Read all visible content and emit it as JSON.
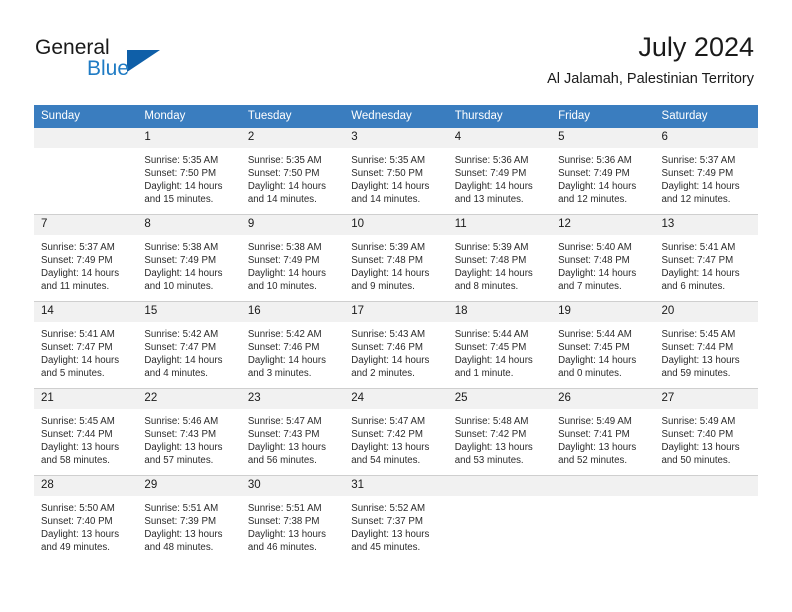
{
  "brand": {
    "name_part1": "General",
    "name_part2": "Blue",
    "accent_color": "#1f7bc4",
    "triangle_color": "#0f5fa8"
  },
  "header": {
    "month_title": "July 2024",
    "location": "Al Jalamah, Palestinian Territory"
  },
  "theme": {
    "header_row_bg": "#3a7dbf",
    "daynum_bg": "#f1f1f1",
    "grid_line": "#cfcfcf",
    "text": "#1a1a1a"
  },
  "weekdays": [
    "Sunday",
    "Monday",
    "Tuesday",
    "Wednesday",
    "Thursday",
    "Friday",
    "Saturday"
  ],
  "weeks": [
    [
      {
        "day": "",
        "sunrise": "",
        "sunset": "",
        "daylight_line1": "",
        "daylight_line2": "",
        "blank": true
      },
      {
        "day": "1",
        "sunrise": "Sunrise: 5:35 AM",
        "sunset": "Sunset: 7:50 PM",
        "daylight_line1": "Daylight: 14 hours",
        "daylight_line2": "and 15 minutes."
      },
      {
        "day": "2",
        "sunrise": "Sunrise: 5:35 AM",
        "sunset": "Sunset: 7:50 PM",
        "daylight_line1": "Daylight: 14 hours",
        "daylight_line2": "and 14 minutes."
      },
      {
        "day": "3",
        "sunrise": "Sunrise: 5:35 AM",
        "sunset": "Sunset: 7:50 PM",
        "daylight_line1": "Daylight: 14 hours",
        "daylight_line2": "and 14 minutes."
      },
      {
        "day": "4",
        "sunrise": "Sunrise: 5:36 AM",
        "sunset": "Sunset: 7:49 PM",
        "daylight_line1": "Daylight: 14 hours",
        "daylight_line2": "and 13 minutes."
      },
      {
        "day": "5",
        "sunrise": "Sunrise: 5:36 AM",
        "sunset": "Sunset: 7:49 PM",
        "daylight_line1": "Daylight: 14 hours",
        "daylight_line2": "and 12 minutes."
      },
      {
        "day": "6",
        "sunrise": "Sunrise: 5:37 AM",
        "sunset": "Sunset: 7:49 PM",
        "daylight_line1": "Daylight: 14 hours",
        "daylight_line2": "and 12 minutes."
      }
    ],
    [
      {
        "day": "7",
        "sunrise": "Sunrise: 5:37 AM",
        "sunset": "Sunset: 7:49 PM",
        "daylight_line1": "Daylight: 14 hours",
        "daylight_line2": "and 11 minutes."
      },
      {
        "day": "8",
        "sunrise": "Sunrise: 5:38 AM",
        "sunset": "Sunset: 7:49 PM",
        "daylight_line1": "Daylight: 14 hours",
        "daylight_line2": "and 10 minutes."
      },
      {
        "day": "9",
        "sunrise": "Sunrise: 5:38 AM",
        "sunset": "Sunset: 7:49 PM",
        "daylight_line1": "Daylight: 14 hours",
        "daylight_line2": "and 10 minutes."
      },
      {
        "day": "10",
        "sunrise": "Sunrise: 5:39 AM",
        "sunset": "Sunset: 7:48 PM",
        "daylight_line1": "Daylight: 14 hours",
        "daylight_line2": "and 9 minutes."
      },
      {
        "day": "11",
        "sunrise": "Sunrise: 5:39 AM",
        "sunset": "Sunset: 7:48 PM",
        "daylight_line1": "Daylight: 14 hours",
        "daylight_line2": "and 8 minutes."
      },
      {
        "day": "12",
        "sunrise": "Sunrise: 5:40 AM",
        "sunset": "Sunset: 7:48 PM",
        "daylight_line1": "Daylight: 14 hours",
        "daylight_line2": "and 7 minutes."
      },
      {
        "day": "13",
        "sunrise": "Sunrise: 5:41 AM",
        "sunset": "Sunset: 7:47 PM",
        "daylight_line1": "Daylight: 14 hours",
        "daylight_line2": "and 6 minutes."
      }
    ],
    [
      {
        "day": "14",
        "sunrise": "Sunrise: 5:41 AM",
        "sunset": "Sunset: 7:47 PM",
        "daylight_line1": "Daylight: 14 hours",
        "daylight_line2": "and 5 minutes."
      },
      {
        "day": "15",
        "sunrise": "Sunrise: 5:42 AM",
        "sunset": "Sunset: 7:47 PM",
        "daylight_line1": "Daylight: 14 hours",
        "daylight_line2": "and 4 minutes."
      },
      {
        "day": "16",
        "sunrise": "Sunrise: 5:42 AM",
        "sunset": "Sunset: 7:46 PM",
        "daylight_line1": "Daylight: 14 hours",
        "daylight_line2": "and 3 minutes."
      },
      {
        "day": "17",
        "sunrise": "Sunrise: 5:43 AM",
        "sunset": "Sunset: 7:46 PM",
        "daylight_line1": "Daylight: 14 hours",
        "daylight_line2": "and 2 minutes."
      },
      {
        "day": "18",
        "sunrise": "Sunrise: 5:44 AM",
        "sunset": "Sunset: 7:45 PM",
        "daylight_line1": "Daylight: 14 hours",
        "daylight_line2": "and 1 minute."
      },
      {
        "day": "19",
        "sunrise": "Sunrise: 5:44 AM",
        "sunset": "Sunset: 7:45 PM",
        "daylight_line1": "Daylight: 14 hours",
        "daylight_line2": "and 0 minutes."
      },
      {
        "day": "20",
        "sunrise": "Sunrise: 5:45 AM",
        "sunset": "Sunset: 7:44 PM",
        "daylight_line1": "Daylight: 13 hours",
        "daylight_line2": "and 59 minutes."
      }
    ],
    [
      {
        "day": "21",
        "sunrise": "Sunrise: 5:45 AM",
        "sunset": "Sunset: 7:44 PM",
        "daylight_line1": "Daylight: 13 hours",
        "daylight_line2": "and 58 minutes."
      },
      {
        "day": "22",
        "sunrise": "Sunrise: 5:46 AM",
        "sunset": "Sunset: 7:43 PM",
        "daylight_line1": "Daylight: 13 hours",
        "daylight_line2": "and 57 minutes."
      },
      {
        "day": "23",
        "sunrise": "Sunrise: 5:47 AM",
        "sunset": "Sunset: 7:43 PM",
        "daylight_line1": "Daylight: 13 hours",
        "daylight_line2": "and 56 minutes."
      },
      {
        "day": "24",
        "sunrise": "Sunrise: 5:47 AM",
        "sunset": "Sunset: 7:42 PM",
        "daylight_line1": "Daylight: 13 hours",
        "daylight_line2": "and 54 minutes."
      },
      {
        "day": "25",
        "sunrise": "Sunrise: 5:48 AM",
        "sunset": "Sunset: 7:42 PM",
        "daylight_line1": "Daylight: 13 hours",
        "daylight_line2": "and 53 minutes."
      },
      {
        "day": "26",
        "sunrise": "Sunrise: 5:49 AM",
        "sunset": "Sunset: 7:41 PM",
        "daylight_line1": "Daylight: 13 hours",
        "daylight_line2": "and 52 minutes."
      },
      {
        "day": "27",
        "sunrise": "Sunrise: 5:49 AM",
        "sunset": "Sunset: 7:40 PM",
        "daylight_line1": "Daylight: 13 hours",
        "daylight_line2": "and 50 minutes."
      }
    ],
    [
      {
        "day": "28",
        "sunrise": "Sunrise: 5:50 AM",
        "sunset": "Sunset: 7:40 PM",
        "daylight_line1": "Daylight: 13 hours",
        "daylight_line2": "and 49 minutes."
      },
      {
        "day": "29",
        "sunrise": "Sunrise: 5:51 AM",
        "sunset": "Sunset: 7:39 PM",
        "daylight_line1": "Daylight: 13 hours",
        "daylight_line2": "and 48 minutes."
      },
      {
        "day": "30",
        "sunrise": "Sunrise: 5:51 AM",
        "sunset": "Sunset: 7:38 PM",
        "daylight_line1": "Daylight: 13 hours",
        "daylight_line2": "and 46 minutes."
      },
      {
        "day": "31",
        "sunrise": "Sunrise: 5:52 AM",
        "sunset": "Sunset: 7:37 PM",
        "daylight_line1": "Daylight: 13 hours",
        "daylight_line2": "and 45 minutes."
      },
      {
        "day": "",
        "sunrise": "",
        "sunset": "",
        "daylight_line1": "",
        "daylight_line2": "",
        "blank": true
      },
      {
        "day": "",
        "sunrise": "",
        "sunset": "",
        "daylight_line1": "",
        "daylight_line2": "",
        "blank": true
      },
      {
        "day": "",
        "sunrise": "",
        "sunset": "",
        "daylight_line1": "",
        "daylight_line2": "",
        "blank": true
      }
    ]
  ]
}
